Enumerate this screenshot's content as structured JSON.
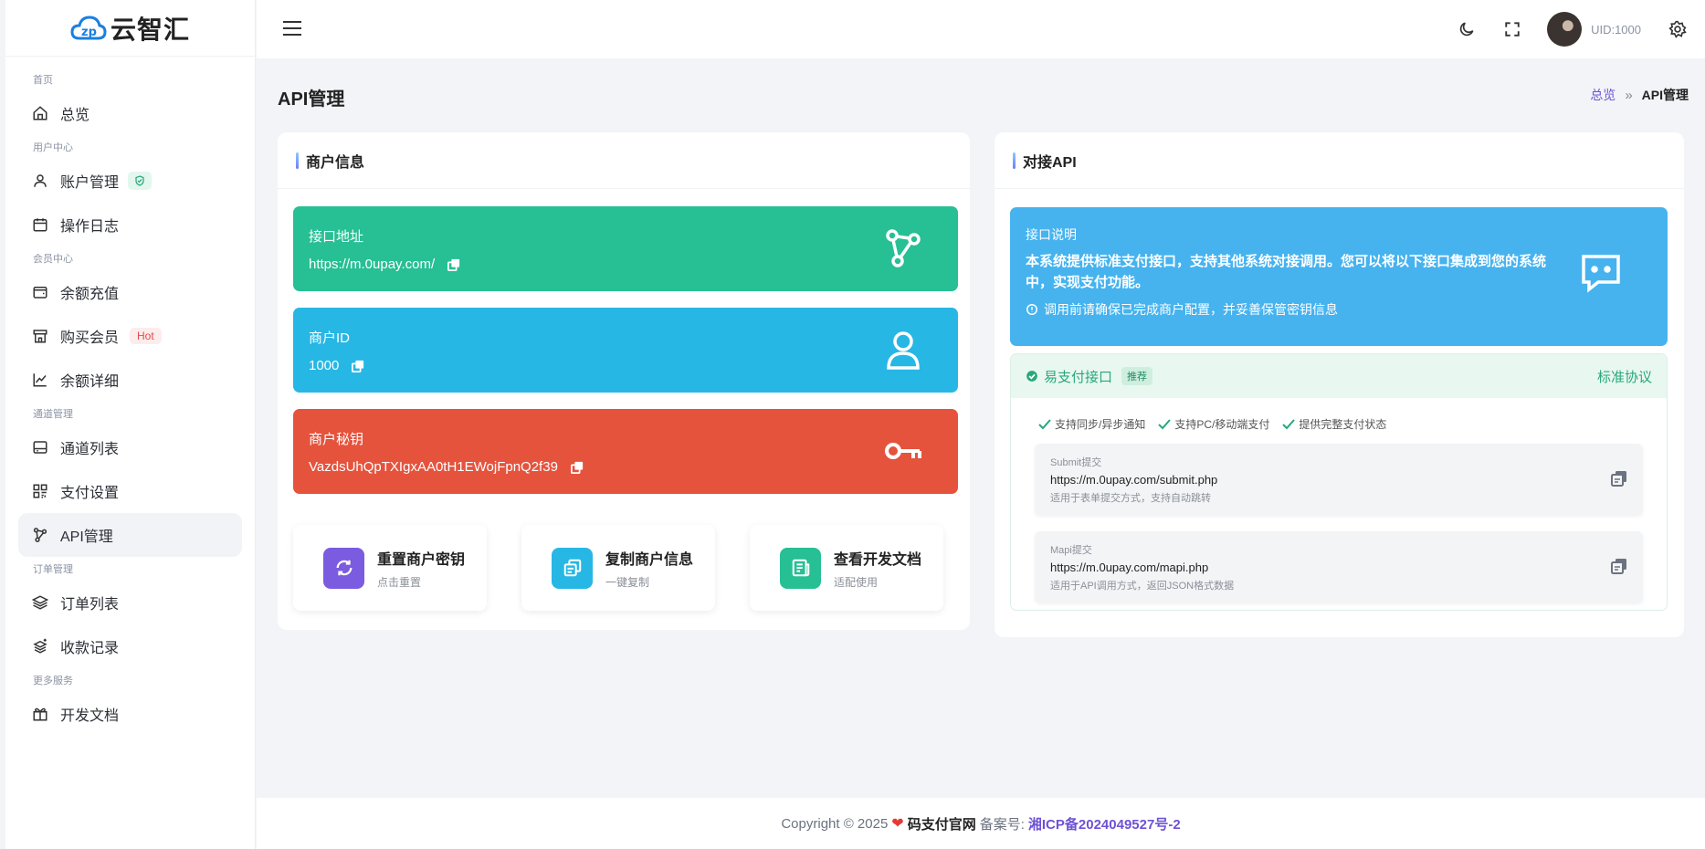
{
  "brand": {
    "logo_text": "云智汇"
  },
  "sidebar": {
    "sections": [
      {
        "label": "首页",
        "items": [
          {
            "label": "总览"
          }
        ]
      },
      {
        "label": "用户中心",
        "items": [
          {
            "label": "账户管理"
          },
          {
            "label": "操作日志"
          }
        ]
      },
      {
        "label": "会员中心",
        "items": [
          {
            "label": "余额充值"
          },
          {
            "label": "购买会员",
            "badge": "Hot"
          },
          {
            "label": "余额详细"
          }
        ]
      },
      {
        "label": "通道管理",
        "items": [
          {
            "label": "通道列表"
          },
          {
            "label": "支付设置"
          },
          {
            "label": "API管理"
          }
        ]
      },
      {
        "label": "订单管理",
        "items": [
          {
            "label": "订单列表"
          },
          {
            "label": "收款记录"
          }
        ]
      },
      {
        "label": "更多服务",
        "items": [
          {
            "label": "开发文档"
          }
        ]
      }
    ]
  },
  "topbar": {
    "uid": "UID:1000"
  },
  "page": {
    "title": "API管理",
    "breadcrumb": {
      "home": "总览",
      "current": "API管理"
    }
  },
  "merchant": {
    "title": "商户信息",
    "endpoint": {
      "label": "接口地址",
      "value": "https://m.0upay.com/",
      "color": "#27bf94"
    },
    "id": {
      "label": "商户ID",
      "value": "1000",
      "color": "#27b7e5"
    },
    "secret": {
      "label": "商户秘钥",
      "value": "VazdsUhQpTXIgxAA0tH1EWojFpnQ2f39",
      "color": "#e5533d"
    },
    "actions": [
      {
        "title": "重置商户密钥",
        "sub": "点击重置",
        "color": "#7b5be0"
      },
      {
        "title": "复制商户信息",
        "sub": "一键复制",
        "color": "#27b7e5"
      },
      {
        "title": "查看开发文档",
        "sub": "适配使用",
        "color": "#27bf94"
      }
    ]
  },
  "api": {
    "title": "对接API",
    "desc_title": "接口说明",
    "desc_body": "本系统提供标准支付接口，支持其他系统对接调用。您可以将以下接口集成到您的系统中，实现支付功能。",
    "desc_note": "调用前请确保已完成商户配置，并妥善保管密钥信息",
    "protocol_name": "易支付接口",
    "protocol_badge": "推荐",
    "protocol_type": "标准协议",
    "features": [
      "支持同步/异步通知",
      "支持PC/移动端支付",
      "提供完整支付状态"
    ],
    "endpoints": [
      {
        "name": "Submit提交",
        "url": "https://m.0upay.com/submit.php",
        "desc": "适用于表单提交方式，支持自动跳转"
      },
      {
        "name": "Mapi提交",
        "url": "https://m.0upay.com/mapi.php",
        "desc": "适用于API调用方式，返回JSON格式数据"
      }
    ]
  },
  "footer": {
    "copyright": "Copyright © 2025",
    "site": "码支付官网",
    "icp_label": "备案号:",
    "icp": "湘ICP备2024049527号-2"
  }
}
